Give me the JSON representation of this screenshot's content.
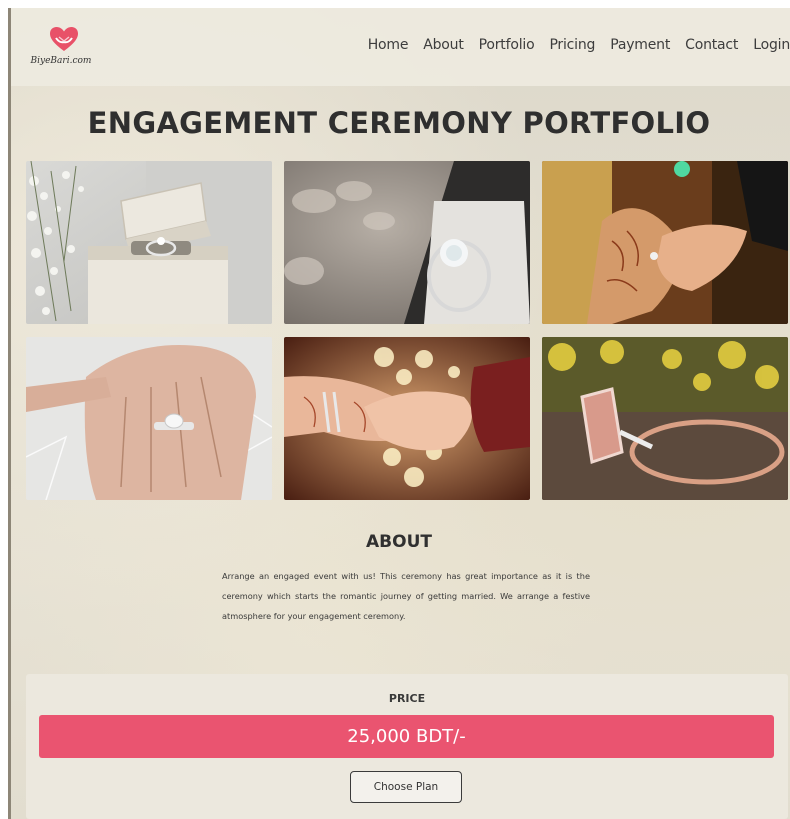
{
  "brand": {
    "logo_text": "BiyeBari.com",
    "accent": "#ea5470"
  },
  "nav": {
    "items": [
      {
        "label": "Home"
      },
      {
        "label": "About"
      },
      {
        "label": "Portfolio"
      },
      {
        "label": "Pricing"
      },
      {
        "label": "Payment"
      },
      {
        "label": "Contact"
      },
      {
        "label": "Login"
      }
    ]
  },
  "page": {
    "title": "ENGAGEMENT CEREMONY PORTFOLIO"
  },
  "gallery": {
    "photos": [
      {
        "name": "ring-box-photo"
      },
      {
        "name": "diamond-ring-photo"
      },
      {
        "name": "henna-hands-photo"
      },
      {
        "name": "hand-with-ring-photo"
      },
      {
        "name": "holding-hands-photo"
      },
      {
        "name": "rose-gold-ring-photo"
      }
    ]
  },
  "about": {
    "title": "ABOUT",
    "text": "Arrange an engaged event with us! This ceremony has great importance as it is the ceremony which starts the romantic journey of getting married. We arrange a festive atmosphere for your engagement ceremony."
  },
  "pricing": {
    "label": "PRICE",
    "value": "25,000 BDT/-",
    "button": "Choose Plan"
  }
}
